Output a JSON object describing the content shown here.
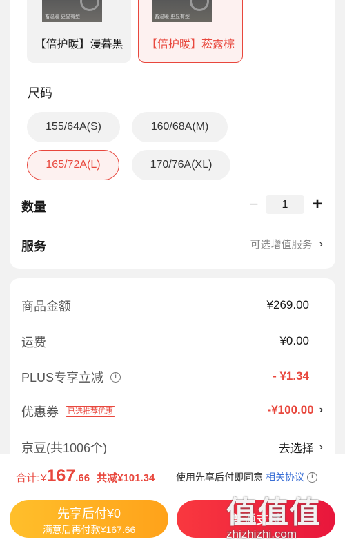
{
  "colors": {
    "accent_red": "#e8473d",
    "pay_red": "#f0283e",
    "later_yellow": "#ffb323",
    "link_blue": "#3a6fd6"
  },
  "color_options": [
    {
      "label": "【倍护暖】漫暮黑",
      "thumb_caption": "蓄温暖 更显有型",
      "selected": false
    },
    {
      "label": "【倍护暖】菘露棕",
      "thumb_caption": "蓄温暖 更显有型",
      "selected": true
    }
  ],
  "size": {
    "title": "尺码",
    "options": [
      {
        "label": "155/64A(S)",
        "selected": false
      },
      {
        "label": "160/68A(M)",
        "selected": false
      },
      {
        "label": "165/72A(L)",
        "selected": true
      },
      {
        "label": "170/76A(XL)",
        "selected": false
      }
    ]
  },
  "quantity": {
    "label": "数量",
    "value": "1",
    "minus": "−",
    "plus": "+"
  },
  "service": {
    "label": "服务",
    "link": "可选增值服务",
    "chevron": "›"
  },
  "price_rows": {
    "goods": {
      "label": "商品金额",
      "value": "¥269.00"
    },
    "shipping": {
      "label": "运费",
      "value": "¥0.00"
    },
    "plus": {
      "label": "PLUS专享立减",
      "info": "i",
      "value": "- ¥1.34"
    },
    "coupon": {
      "label": "优惠券",
      "tag": "已选推荐优惠",
      "value": "-¥100.00",
      "chevron": "›"
    },
    "jingdou": {
      "label": "京豆(共1006个)",
      "value": "去选择",
      "chevron": "›"
    }
  },
  "total": {
    "label": "合计:",
    "currency": "¥",
    "amount_int": "167",
    "amount_dec": ".66",
    "saved": "共减¥101.34"
  },
  "agreement": {
    "text": "使用先享后付即同意",
    "link": "相关协议",
    "info": "i"
  },
  "btn_later": {
    "line1": "先享后付¥0",
    "line2": "满意后再付款¥167.66"
  },
  "btn_pay": {
    "label": "普通支付"
  },
  "watermark": {
    "glyphs": "值值值",
    "url": "zhizhizhi.com"
  }
}
